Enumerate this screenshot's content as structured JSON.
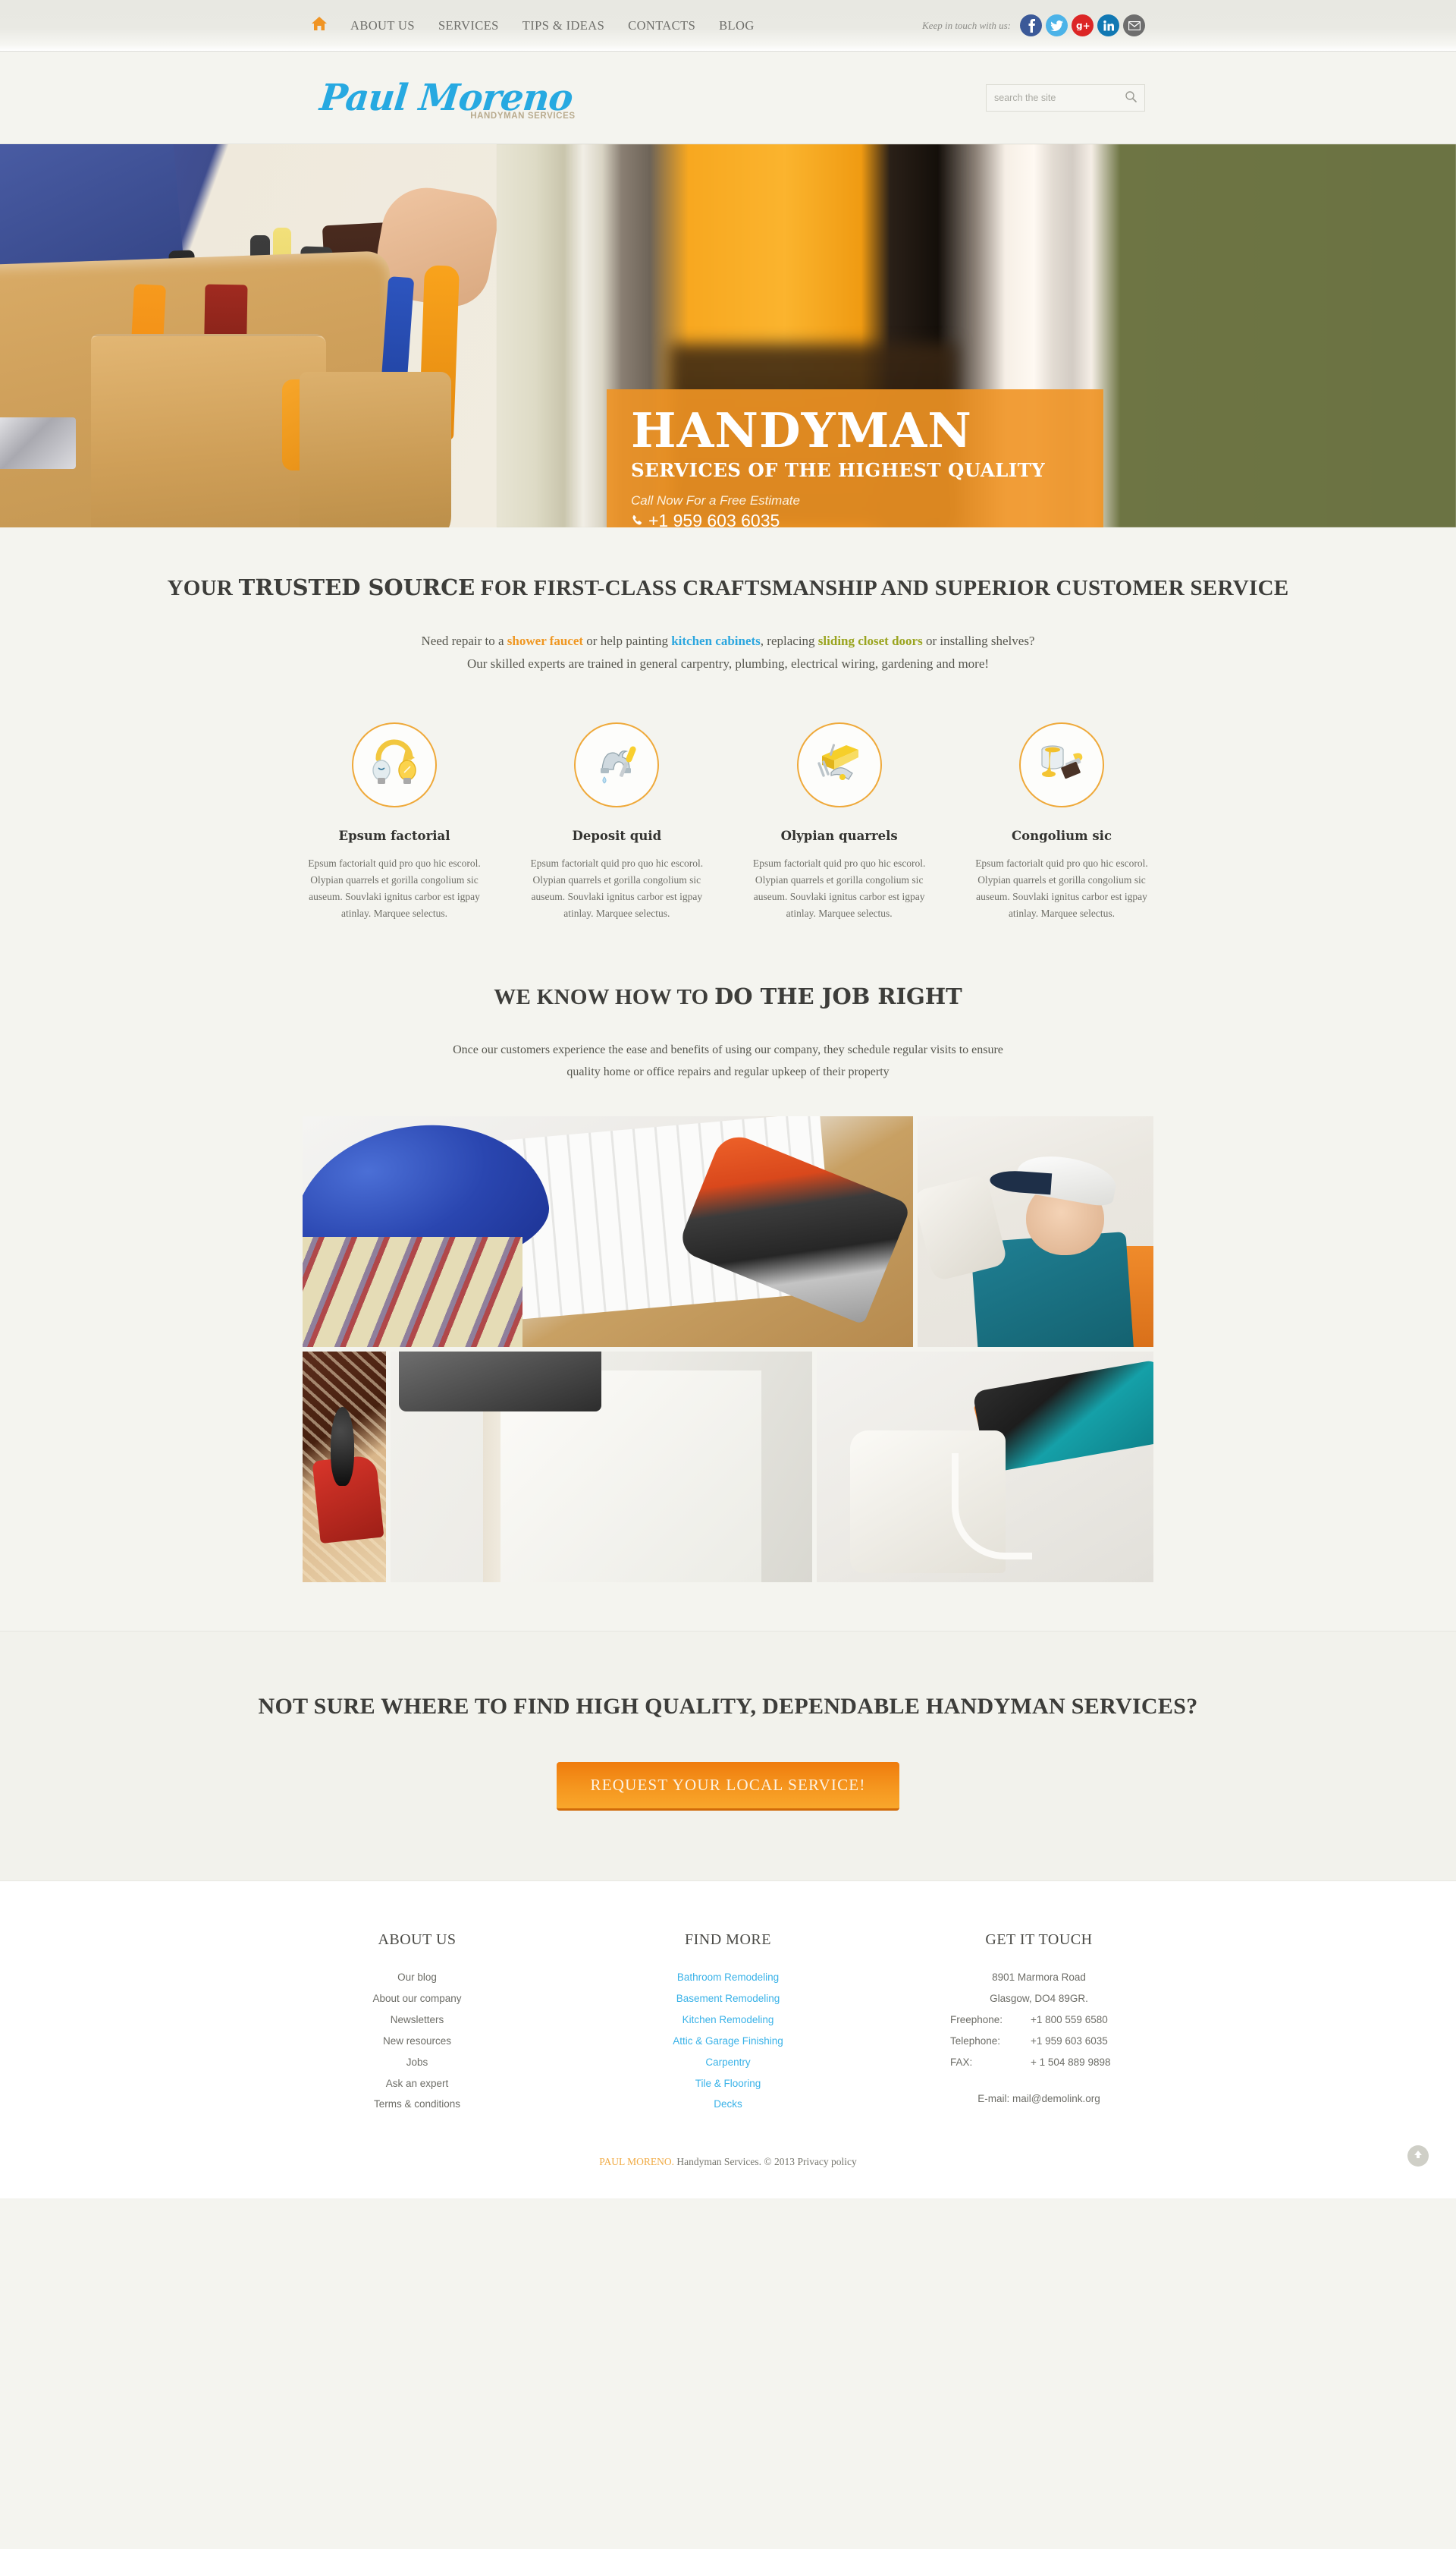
{
  "topbar": {
    "home_icon": "home-icon",
    "nav": [
      {
        "label": "ABOUT US"
      },
      {
        "label": "SERVICES"
      },
      {
        "label": "TIPS & IDEAS"
      },
      {
        "label": "CONTACTS"
      },
      {
        "label": "BLOG"
      }
    ],
    "social_label": "Keep in touch with us:",
    "social": [
      {
        "name": "facebook-icon",
        "color": "#3b5998"
      },
      {
        "name": "twitter-icon",
        "color": "#4cb3e8"
      },
      {
        "name": "google-plus-icon",
        "color": "#dc2626"
      },
      {
        "name": "linkedin-icon",
        "color": "#1178b3"
      },
      {
        "name": "email-icon",
        "color": "#6e6e6e"
      }
    ]
  },
  "header": {
    "logo_name": "Paul Moreno",
    "logo_sub": "HANDYMAN SERVICES",
    "logo_color": "#27a9e1",
    "search_placeholder": "search the site",
    "search_value": ""
  },
  "hero": {
    "title": "HANDYMAN",
    "subtitle": "SERVICES OF THE HIGHEST QUALITY",
    "call_text": "Call Now For a Free Estimate",
    "phone": "+1 959 603 6035",
    "accent_color": "#f09423"
  },
  "intro": {
    "title_pre": "YOUR ",
    "title_bold": "TRUSTED SOURCE",
    "title_post": " FOR FIRST-CLASS CRAFTSMANSHIP AND SUPERIOR CUSTOMER SERVICE",
    "copy_1": "Need repair to a ",
    "link_1": "shower faucet",
    "copy_2": " or help painting ",
    "link_2": "kitchen cabinets",
    "copy_3": ", replacing ",
    "link_3": "sliding closet doors",
    "copy_4": " or installing shelves? Our skilled experts are trained in general carpentry, plumbing, electrical wiring, gardening and more!",
    "link_1_color": "#ef9722",
    "link_2_color": "#2da7df",
    "link_3_color": "#9aa41f"
  },
  "services": [
    {
      "icon": "lightbulb-swap-icon",
      "title": "Epsum factorial",
      "text": "Epsum factorialt quid pro quo hic escorol. Olypian quarrels et gorilla congolium sic auseum. Souvlaki ignitus carbor est igpay atinlay. Marquee selectus."
    },
    {
      "icon": "faucet-screwdriver-icon",
      "title": "Deposit quid",
      "text": "Epsum factorialt quid pro quo hic escorol. Olypian quarrels et gorilla congolium sic auseum. Souvlaki ignitus carbor est igpay atinlay. Marquee selectus."
    },
    {
      "icon": "hammer-nails-lumber-icon",
      "title": "Olypian quarrels",
      "text": "Epsum factorialt quid pro quo hic escorol. Olypian quarrels et gorilla congolium sic auseum. Souvlaki ignitus carbor est igpay atinlay. Marquee selectus."
    },
    {
      "icon": "paint-can-brush-icon",
      "title": "Congolium sic",
      "text": "Epsum factorialt quid pro quo hic escorol. Olypian quarrels et gorilla congolium sic auseum. Souvlaki ignitus carbor est igpay atinlay. Marquee selectus."
    }
  ],
  "jobright": {
    "title_pre": "WE KNOW HOW TO ",
    "title_bold": "DO THE JOB RIGHT",
    "copy": "Once our customers experience the ease and benefits of using our company, they schedule regular visits to ensure quality home or office repairs and regular upkeep of their property"
  },
  "gallery": [
    {
      "name": "hard-hat-blueprint-drill-photo"
    },
    {
      "name": "woman-painter-ladder-photo"
    },
    {
      "name": "wood-plane-shavings-photo"
    },
    {
      "name": "cabinet-installation-photo"
    },
    {
      "name": "drilling-wall-hook-photo"
    }
  ],
  "cta": {
    "title": "NOT SURE WHERE TO FIND HIGH QUALITY, DEPENDABLE HANDYMAN SERVICES?",
    "button_label": "REQUEST YOUR LOCAL SERVICE!",
    "button_color": "#f5951e"
  },
  "footer": {
    "about": {
      "title": "ABOUT US",
      "items": [
        "Our blog",
        "About our company",
        "Newsletters",
        "New resources",
        "Jobs",
        "Ask an expert",
        "Terms & conditions"
      ]
    },
    "find_more": {
      "title": "FIND MORE",
      "link_color": "#39b2e8",
      "items": [
        "Bathroom Remodeling",
        "Basement Remodeling",
        "Kitchen Remodeling",
        "Attic & Garage Finishing",
        "Carpentry",
        "Tile & Flooring",
        "Decks"
      ]
    },
    "contact": {
      "title": "GET IT TOUCH",
      "address_1": "8901 Marmora Road",
      "address_2": "Glasgow, DO4 89GR.",
      "rows": [
        {
          "label": "Freephone:",
          "value": "+1 800 559 6580"
        },
        {
          "label": "Telephone:",
          "value": "+1 959 603 6035"
        },
        {
          "label": "FAX:",
          "value": "+ 1 504 889 9898"
        }
      ],
      "email": "E-mail: mail@demolink.org"
    }
  },
  "copyright": {
    "brand": "PAUL MORENO.",
    "text": " Handyman Services. © 2013 ",
    "privacy": "Privacy policy"
  },
  "back_to_top": "back-to-top-icon"
}
